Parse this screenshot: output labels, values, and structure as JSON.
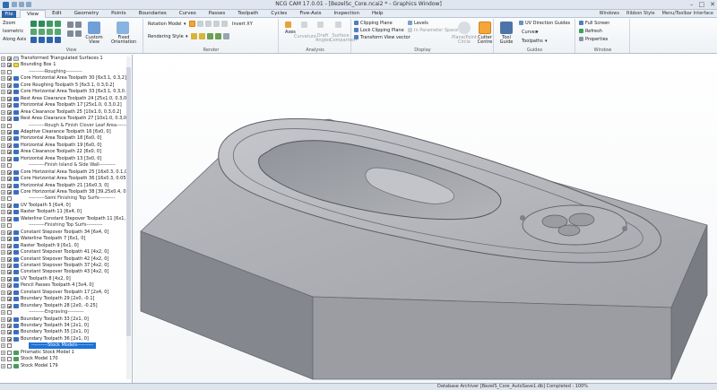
{
  "window": {
    "title": "NCG CAM 17.0.01 - [BezelSc_Core.ncai2 * - Graphics Window]",
    "controls": [
      "–",
      "□",
      "✕"
    ]
  },
  "menu": {
    "file": "File",
    "tabs": [
      "View",
      "Edit",
      "Geometry",
      "Points",
      "Boundaries",
      "Curves",
      "Passes",
      "Toolpath",
      "Cycles",
      "Five-Axis",
      "Inspection",
      "Help"
    ],
    "active_tab": "View",
    "right_items": [
      "Windows",
      "Ribbon Style",
      "Menu/Toolbar Interface"
    ]
  },
  "ribbon": {
    "view": {
      "label": "View",
      "zoom": "Zoom",
      "isometric": "Isometric",
      "along_axis": "Along Axis",
      "custom_view": "Custom View",
      "fixed_orientation": "Fixed Orientation"
    },
    "render": {
      "label": "Render",
      "rotation_model": "Rotation Model",
      "rendering_style": "Rendering Style",
      "invert_xy": "Invert XY"
    },
    "analysis": {
      "label": "Analysis",
      "axes": "Axes",
      "curvature": "Curvature",
      "draft_angles": "Draft Angles",
      "surface_comparison": "Surface Comparison"
    },
    "display": {
      "label": "Display",
      "clipping_plane": "Clipping Plane",
      "lock_clipping_plane": "Lock Clipping Plane",
      "transform_view_vector": "Transform View vector",
      "levels": "Levels",
      "parameter_space": "In Parameter Space",
      "plane_point_circle": "Plane/Point Circle",
      "cutter_centre": "Cutter Centre"
    },
    "guides": {
      "label": "Guides",
      "tool_guide": "Tool Guide",
      "uv_direction_guides": "UV Direction Guides",
      "curves": "Curves",
      "toolpaths": "Toolpaths"
    },
    "window": {
      "label": "Window",
      "full_screen": "Full Screen",
      "refresh": "Refresh",
      "properties": "Properties"
    }
  },
  "tree": {
    "items": [
      {
        "text": "Transformed Triangulated Surfaces 1",
        "kind": "wf",
        "checked": true,
        "sep": false
      },
      {
        "text": "Bounding Box 1",
        "kind": "bd",
        "checked": true,
        "sep": false
      },
      {
        "text": "----------Roughing----------",
        "kind": "",
        "checked": false,
        "sep": true
      },
      {
        "text": "Core Horizontal Area Toolpath 30 [6x3.1, 0.3,2]",
        "kind": "tp",
        "checked": true,
        "sep": false
      },
      {
        "text": "Core Roughing Toolpath 5 [6x3.1, 0.3,0.2]",
        "kind": "tp",
        "checked": true,
        "sep": false
      },
      {
        "text": "Core Horizontal Area Toolpath 33 [6x3.1, 0.3,0.2]",
        "kind": "tp",
        "checked": true,
        "sep": false
      },
      {
        "text": "Rest Area Clearance Toolpath 24 [25x1.0, 0.3,0.2]",
        "kind": "tp",
        "checked": true,
        "sep": false
      },
      {
        "text": "Horizontal Area Toolpath 17 [25x1.0, 0.3,0.2]",
        "kind": "tp",
        "checked": true,
        "sep": false
      },
      {
        "text": "Area Clearance Toolpath 25 [10x1.0, 0.3,0.2]",
        "kind": "tp",
        "checked": true,
        "sep": false
      },
      {
        "text": "Rest Area Clearance Toolpath 27 [10x1.0, 0.3,0.2]",
        "kind": "tp",
        "checked": true,
        "sep": false
      },
      {
        "text": "----------Rough & Finish Clover Leaf Area----------",
        "kind": "",
        "checked": false,
        "sep": true
      },
      {
        "text": "Adaptive Clearance Toolpath 16 [6x0, 0]",
        "kind": "tp",
        "checked": true,
        "sep": false
      },
      {
        "text": "Horizontal Area Toolpath 18 [6x0, 0]",
        "kind": "tp",
        "checked": true,
        "sep": false
      },
      {
        "text": "Horizontal Area Toolpath 19 [6x0, 0]",
        "kind": "tp",
        "checked": true,
        "sep": false
      },
      {
        "text": "Area Clearance Toolpath 22 [6x0, 0]",
        "kind": "tp",
        "checked": true,
        "sep": false
      },
      {
        "text": "Horizontal Area Toolpath 13 [3x0, 0]",
        "kind": "tp",
        "checked": true,
        "sep": false
      },
      {
        "text": "----------Finish Island & Side Wall----------",
        "kind": "",
        "checked": false,
        "sep": true
      },
      {
        "text": "Core Horizontal Area Toolpath 25 [16x0.3, 0.1,0.05]",
        "kind": "tp",
        "checked": true,
        "sep": false
      },
      {
        "text": "Core Horizontal Area Toolpath 36 [16x0.3, 0.05]",
        "kind": "tp",
        "checked": true,
        "sep": false
      },
      {
        "text": "Horizontal Area Toolpath 21 [16x0.3, 0]",
        "kind": "tp",
        "checked": true,
        "sep": false
      },
      {
        "text": "Core Horizontal Area Toolpath 38 [39.25x0.4, 0.05,0]",
        "kind": "tp",
        "checked": true,
        "sep": false
      },
      {
        "text": "----------Semi Finishing Top Surfs----------",
        "kind": "",
        "checked": false,
        "sep": true
      },
      {
        "text": "UV Toolpath 5 [6x4, 0]",
        "kind": "tp",
        "checked": true,
        "sep": false
      },
      {
        "text": "Raster Toolpath 11 [6x4, 0]",
        "kind": "tp",
        "checked": true,
        "sep": false
      },
      {
        "text": "Waterline Constant Stepover Toolpath 11 [6x1, 0.1]",
        "kind": "tp",
        "checked": true,
        "sep": false
      },
      {
        "text": "----------Finishing Top Surfs----------",
        "kind": "",
        "checked": false,
        "sep": true
      },
      {
        "text": "Constant Stepover Toolpath 34 [6x4, 0]",
        "kind": "tp",
        "checked": true,
        "sep": false
      },
      {
        "text": "Waterline Toolpath 7 [6x1, 0]",
        "kind": "tp",
        "checked": true,
        "sep": false
      },
      {
        "text": "Raster Toolpath 9 [6x1, 0]",
        "kind": "tp",
        "checked": true,
        "sep": false
      },
      {
        "text": "Constant Stepover Toolpath 41 [4x2, 0]",
        "kind": "tp",
        "checked": true,
        "sep": false
      },
      {
        "text": "Constant Stepover Toolpath 42 [4x2, 0]",
        "kind": "tp",
        "checked": true,
        "sep": false
      },
      {
        "text": "Constant Stepover Toolpath 37 [4x2, 0]",
        "kind": "tp",
        "checked": true,
        "sep": false
      },
      {
        "text": "Constant Stepover Toolpath 43 [4x2, 0]",
        "kind": "tp",
        "checked": true,
        "sep": false
      },
      {
        "text": "UV Toolpath 8 [4x2, 0]",
        "kind": "tp",
        "checked": true,
        "sep": false
      },
      {
        "text": "Pencil Passes Toolpath 4 [3x4, 0]",
        "kind": "tp",
        "checked": true,
        "sep": false
      },
      {
        "text": "Constant Stepover Toolpath 17 [2x4, 0]",
        "kind": "tp",
        "checked": true,
        "sep": false
      },
      {
        "text": "Boundary Toolpath 29 [2x0, -0.1]",
        "kind": "tp",
        "checked": true,
        "sep": false
      },
      {
        "text": "Boundary Toolpath 28 [2x0, -0.25]",
        "kind": "tp",
        "checked": true,
        "sep": false
      },
      {
        "text": "----------Engraving----------",
        "kind": "",
        "checked": false,
        "sep": true
      },
      {
        "text": "Boundary Toolpath 33 [2x1, 0]",
        "kind": "tp",
        "checked": true,
        "sep": false
      },
      {
        "text": "Boundary Toolpath 34 [2x1, 0]",
        "kind": "tp",
        "checked": true,
        "sep": false
      },
      {
        "text": "Boundary Toolpath 35 [2x1, 0]",
        "kind": "tp",
        "checked": true,
        "sep": false
      },
      {
        "text": "Boundary Toolpath 36 [2x1, 0]",
        "kind": "tp",
        "checked": true,
        "sep": false
      },
      {
        "text": "----------Stock Models----------",
        "kind": "",
        "checked": false,
        "sep": true,
        "selected": true
      },
      {
        "text": "Prismatic Stock Model 1",
        "kind": "st",
        "checked": false,
        "sep": false
      },
      {
        "text": "Stock Model 170",
        "kind": "st",
        "checked": false,
        "sep": false
      },
      {
        "text": "Stock Model 179",
        "kind": "st",
        "checked": false,
        "sep": false
      }
    ]
  },
  "status": {
    "text": "Database Archiver [BezelS_Core_AutoSave1.db] Completed : 100%"
  },
  "colors": {
    "accent": "#2e63a8",
    "selection": "#1e72d6",
    "model_top": "#a8aab0",
    "model_side": "#7c7e85"
  }
}
